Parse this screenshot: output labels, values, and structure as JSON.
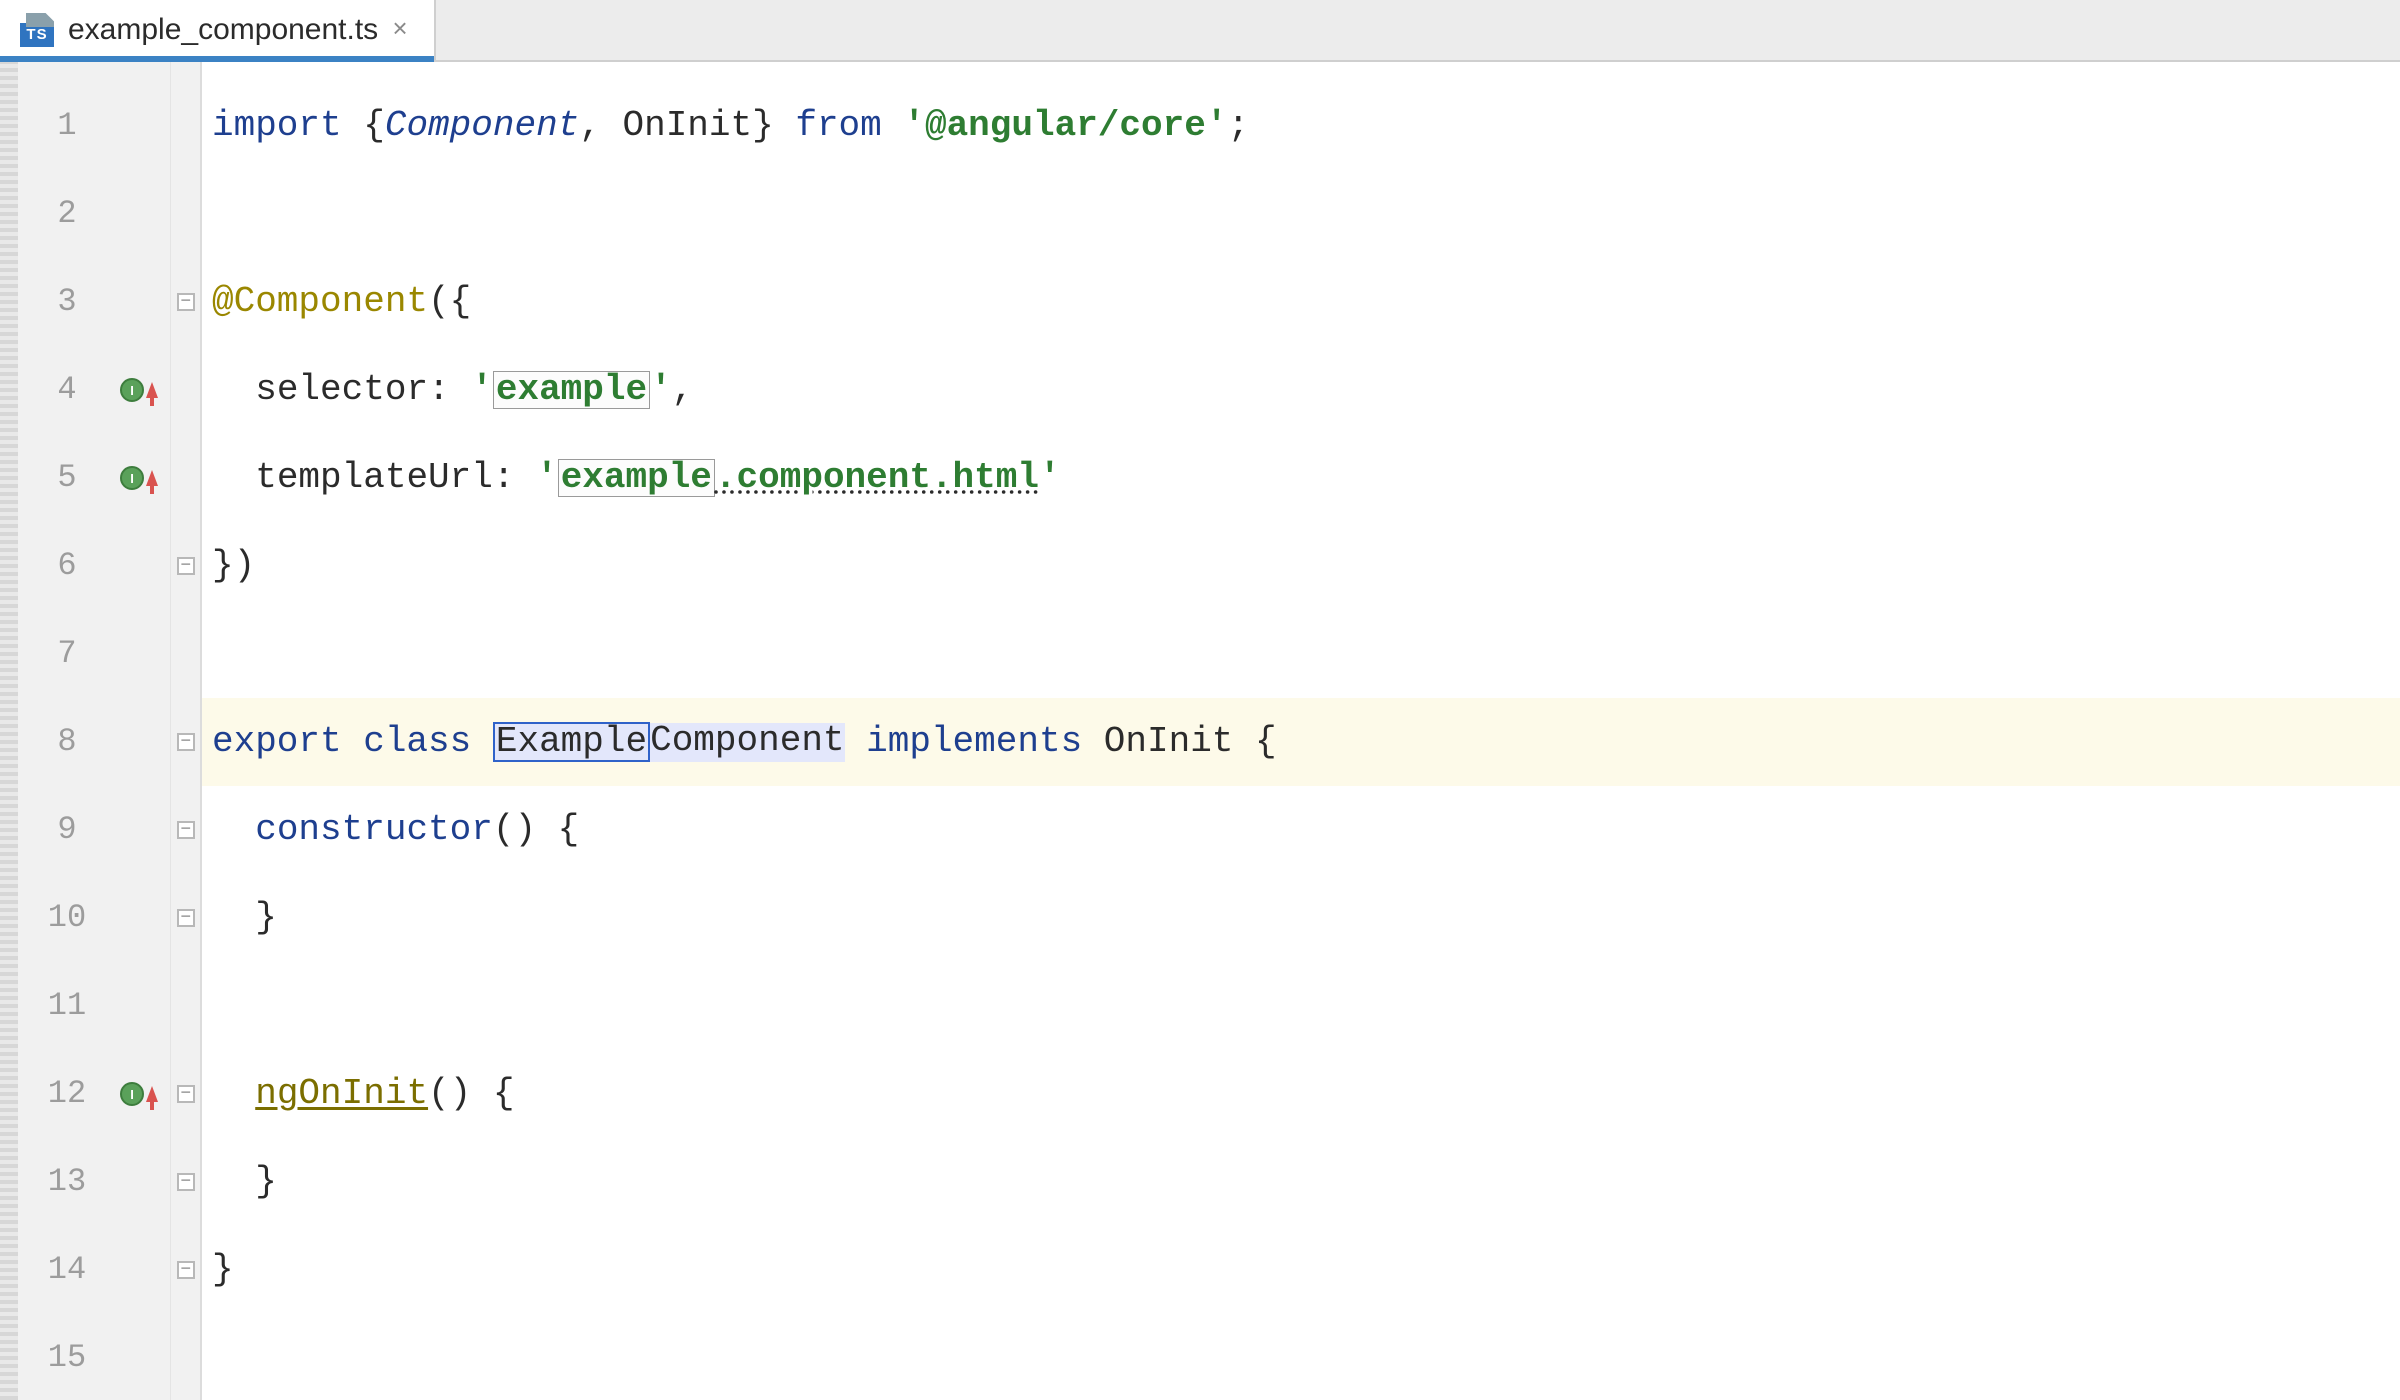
{
  "tab": {
    "filename": "example_component.ts",
    "icon_badge": "TS",
    "active": true
  },
  "gutter": {
    "line_start": 1,
    "line_end": 15,
    "markers": {
      "4": {
        "type": "implements-override"
      },
      "5": {
        "type": "implements-override"
      },
      "12": {
        "type": "implements-override"
      }
    },
    "folds": [
      3,
      6,
      8,
      9,
      10,
      12,
      13,
      14
    ]
  },
  "code": {
    "current_line": 8,
    "rename_target": "Example",
    "lines": {
      "1": {
        "tokens": [
          {
            "t": "import ",
            "c": "kw"
          },
          {
            "t": "{",
            "c": "punc"
          },
          {
            "t": "Component",
            "c": "kwi"
          },
          {
            "t": ", ",
            "c": "punc"
          },
          {
            "t": "OnInit",
            "c": "id"
          },
          {
            "t": "} ",
            "c": "punc"
          },
          {
            "t": "from ",
            "c": "kw"
          },
          {
            "t": "'@angular/core'",
            "c": "str"
          },
          {
            "t": ";",
            "c": "punc"
          }
        ]
      },
      "2": {
        "tokens": []
      },
      "3": {
        "tokens": [
          {
            "t": "@Component",
            "c": "dec"
          },
          {
            "t": "({",
            "c": "punc"
          }
        ]
      },
      "4": {
        "indent": 1,
        "tokens": [
          {
            "t": "selector: ",
            "c": "id"
          },
          {
            "t": "'",
            "c": "str"
          },
          {
            "t": "example",
            "c": "str",
            "rename": true,
            "squiggle": true
          },
          {
            "t": "'",
            "c": "str"
          },
          {
            "t": ",",
            "c": "punc"
          }
        ]
      },
      "5": {
        "indent": 1,
        "tokens": [
          {
            "t": "templateUrl: ",
            "c": "id"
          },
          {
            "t": "'",
            "c": "str"
          },
          {
            "t": "example",
            "c": "str",
            "rename": true
          },
          {
            "t": ".component.html",
            "c": "dstr"
          },
          {
            "t": "'",
            "c": "str"
          }
        ]
      },
      "6": {
        "tokens": [
          {
            "t": "})",
            "c": "punc"
          }
        ]
      },
      "7": {
        "tokens": []
      },
      "8": {
        "tokens": [
          {
            "t": "export class ",
            "c": "kw"
          },
          {
            "t": "Example",
            "c": "id",
            "primary": true,
            "squiggle": true
          },
          {
            "t": "Component",
            "c": "id",
            "secondary": true,
            "squiggle": true
          },
          {
            "t": " ",
            "c": "id"
          },
          {
            "t": "implements ",
            "c": "kw"
          },
          {
            "t": "OnInit {",
            "c": "id"
          }
        ]
      },
      "9": {
        "indent": 1,
        "tokens": [
          {
            "t": "constructor",
            "c": "kw"
          },
          {
            "t": "() {",
            "c": "punc"
          }
        ]
      },
      "10": {
        "indent": 1,
        "tokens": [
          {
            "t": "}",
            "c": "punc"
          }
        ]
      },
      "11": {
        "tokens": []
      },
      "12": {
        "indent": 1,
        "tokens": [
          {
            "t": "ngOnInit",
            "c": "mtd"
          },
          {
            "t": "() {",
            "c": "punc"
          }
        ]
      },
      "13": {
        "indent": 1,
        "tokens": [
          {
            "t": "}",
            "c": "punc"
          }
        ]
      },
      "14": {
        "tokens": [
          {
            "t": "}",
            "c": "punc"
          }
        ]
      },
      "15": {
        "tokens": []
      }
    }
  }
}
